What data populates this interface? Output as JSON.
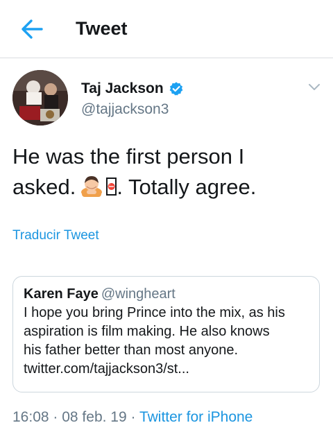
{
  "header": {
    "back_icon": "arrow-left-icon",
    "title": "Tweet",
    "accent_color": "#1da1f2"
  },
  "tweet": {
    "author": {
      "name": "Taj Jackson",
      "handle": "@tajjackson3",
      "verified_icon": "verified-badge-icon",
      "avatar_icon": "profile-photo"
    },
    "menu_icon": "chevron-down-icon",
    "text": {
      "line1": "He was the first person I",
      "line2_start": "asked.",
      "emoji": "person-bowing-icon",
      "unsupported_glyph": "⛔",
      "line2_end": ". Totally agree."
    },
    "translate_label": "Traducir Tweet",
    "quote": {
      "name": "Karen Faye",
      "handle": "@wingheart",
      "lines": [
        "I hope you bring Prince into the mix, as his",
        "aspiration is film making. He also knows",
        "his father better than most anyone.",
        "twitter.com/tajjackson3/st..."
      ]
    },
    "meta": {
      "time": "16:08",
      "sep1": " · ",
      "date": "08 feb. 19",
      "sep2": " · ",
      "source": "Twitter for iPhone"
    }
  }
}
